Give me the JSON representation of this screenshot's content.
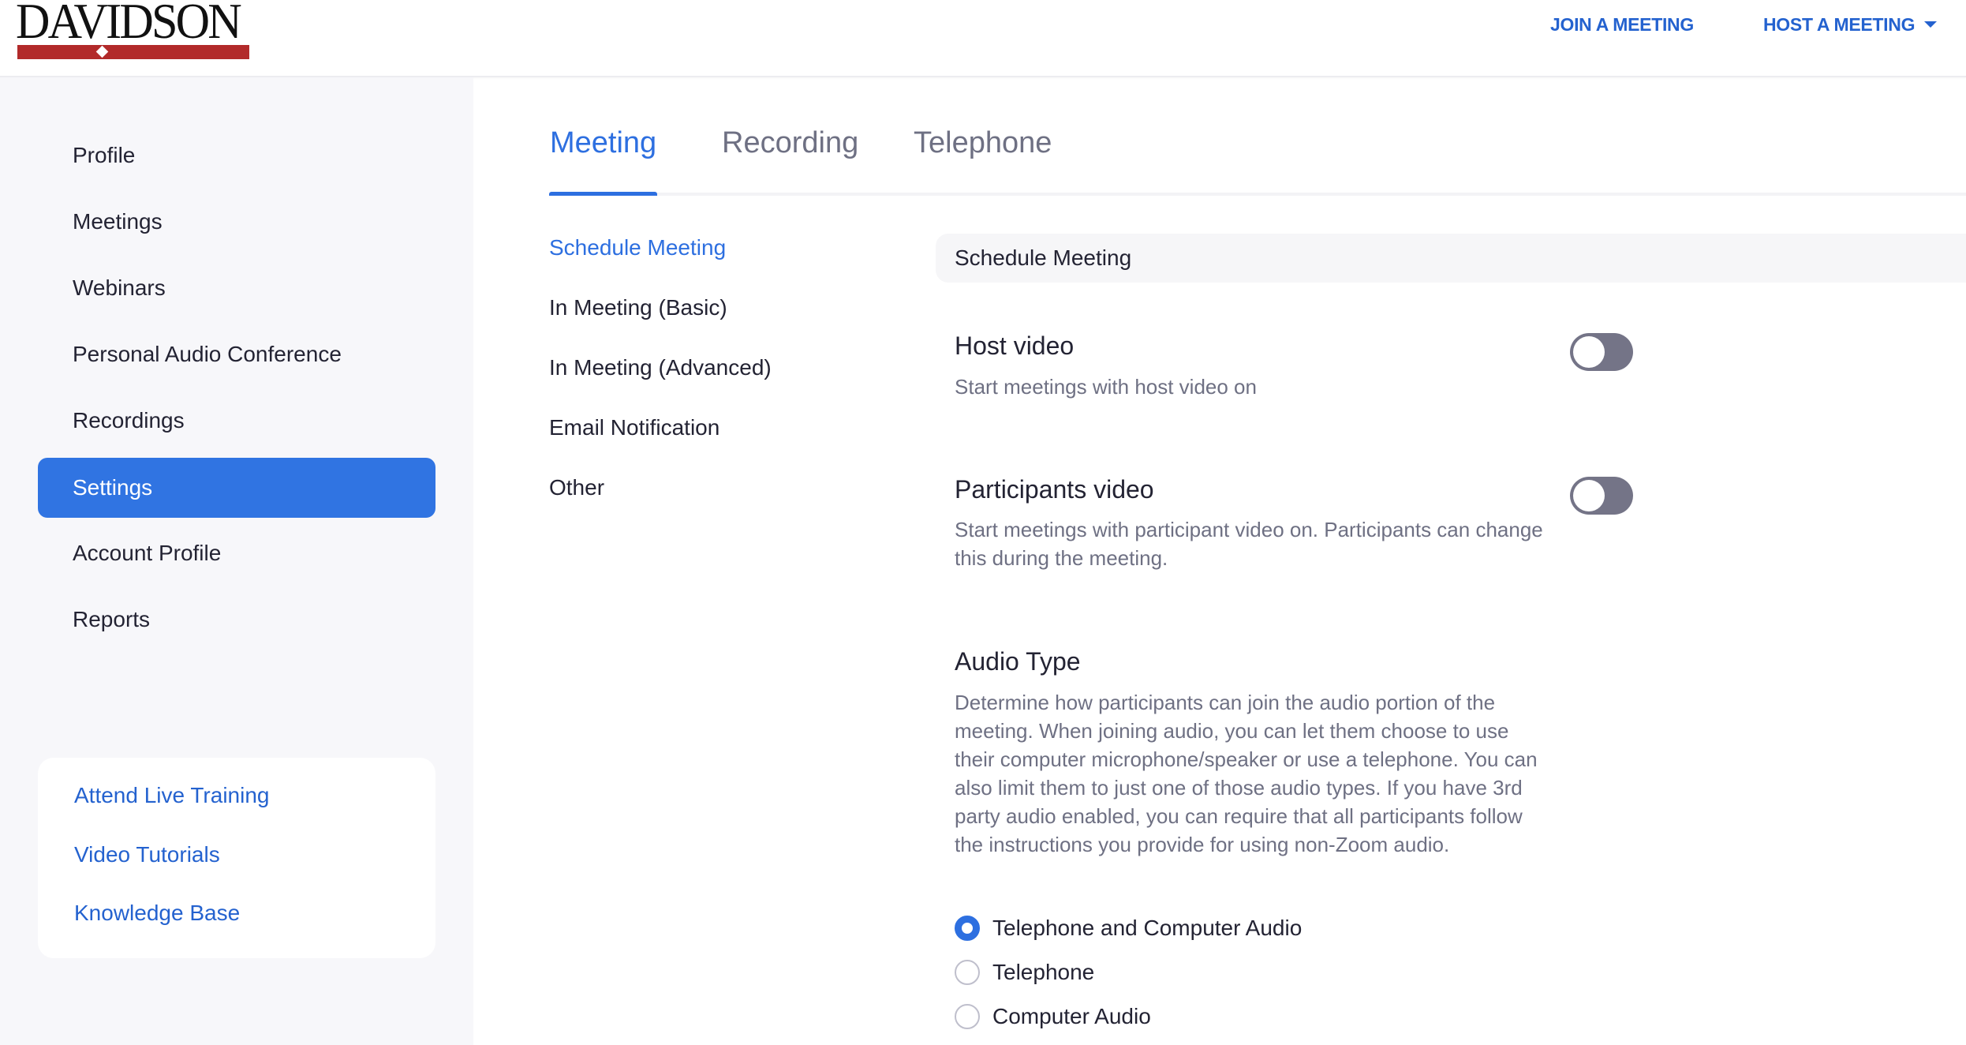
{
  "header": {
    "logo_text": "DAVIDSON",
    "join_meeting": "JOIN A MEETING",
    "host_meeting": "HOST A MEETING"
  },
  "sidebar": {
    "items": [
      {
        "label": "Profile",
        "active": false
      },
      {
        "label": "Meetings",
        "active": false
      },
      {
        "label": "Webinars",
        "active": false
      },
      {
        "label": "Personal Audio Conference",
        "active": false
      },
      {
        "label": "Recordings",
        "active": false
      },
      {
        "label": "Settings",
        "active": true
      },
      {
        "label": "Account Profile",
        "active": false
      },
      {
        "label": "Reports",
        "active": false
      }
    ],
    "help_links": [
      {
        "label": "Attend Live Training"
      },
      {
        "label": "Video Tutorials"
      },
      {
        "label": "Knowledge Base"
      }
    ]
  },
  "tabs": [
    {
      "label": "Meeting",
      "active": true
    },
    {
      "label": "Recording",
      "active": false
    },
    {
      "label": "Telephone",
      "active": false
    }
  ],
  "subnav": [
    {
      "label": "Schedule Meeting",
      "active": true
    },
    {
      "label": "In Meeting (Basic)",
      "active": false
    },
    {
      "label": "In Meeting (Advanced)",
      "active": false
    },
    {
      "label": "Email Notification",
      "active": false
    },
    {
      "label": "Other",
      "active": false
    }
  ],
  "content": {
    "section_title": "Schedule Meeting",
    "settings": [
      {
        "title": "Host video",
        "description": "Start meetings with host video on",
        "enabled": false
      },
      {
        "title": "Participants video",
        "description": "Start meetings with participant video on. Participants can change this during the meeting.",
        "enabled": false
      }
    ],
    "audio_type": {
      "title": "Audio Type",
      "description": "Determine how participants can join the audio portion of the meeting. When joining audio, you can let them choose to use their computer microphone/speaker or use a telephone. You can also limit them to just one of those audio types. If you have 3rd party audio enabled, you can require that all participants follow the instructions you provide for using non-Zoom audio.",
      "options": [
        {
          "label": "Telephone and Computer Audio",
          "selected": true
        },
        {
          "label": "Telephone",
          "selected": false
        },
        {
          "label": "Computer Audio",
          "selected": false
        }
      ]
    }
  },
  "colors": {
    "accent": "#2d6fe0",
    "sidebar_active": "#3074e2",
    "link": "#2462cf",
    "toggle_off": "#747487",
    "brand_red": "#b22a2a"
  }
}
